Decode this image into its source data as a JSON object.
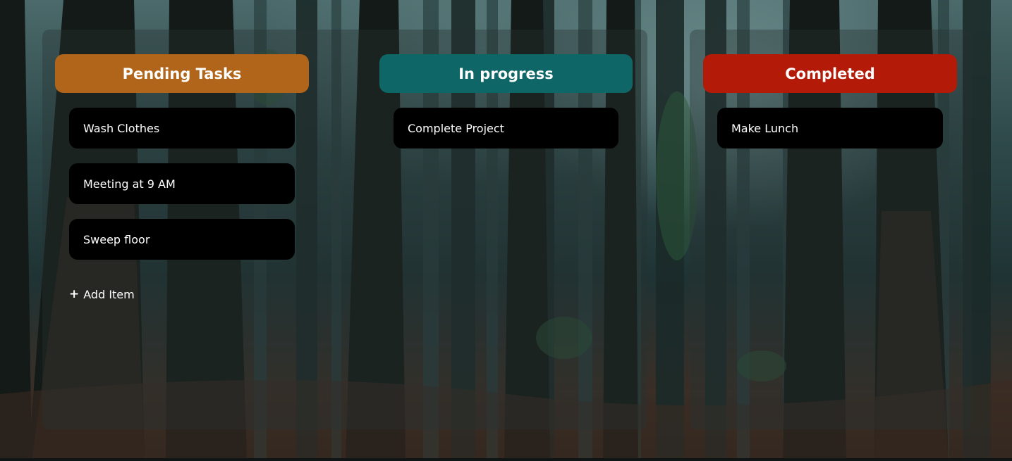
{
  "columns": [
    {
      "title": "Pending Tasks",
      "color": "#b0651a",
      "items": [
        "Wash Clothes",
        "Meeting at 9 AM",
        "Sweep floor"
      ],
      "add_item_label": "Add Item"
    },
    {
      "title": "In progress",
      "color": "#0e6666",
      "items": [
        "Complete Project"
      ]
    },
    {
      "title": "Completed",
      "color": "#b31b08",
      "items": [
        "Make Lunch"
      ]
    }
  ],
  "icons": {
    "add": "plus-icon"
  }
}
